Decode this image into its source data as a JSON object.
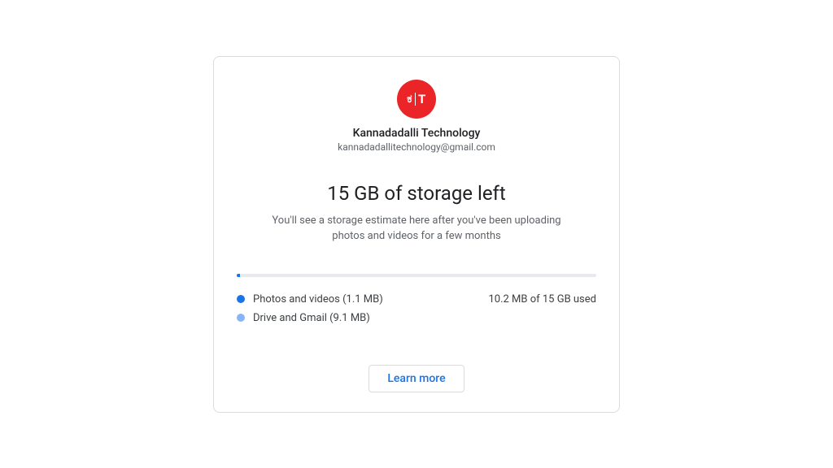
{
  "account": {
    "avatar_left": "ಕ",
    "avatar_right": "T",
    "name": "Kannadadalli Technology",
    "email": "kannadadallitechnology@gmail.com"
  },
  "storage": {
    "title": "15 GB of storage left",
    "subtitle": "You'll see a storage estimate here after you've been uploading photos and videos for a few months",
    "usage_summary": "10.2 MB of 15 GB used",
    "legend": {
      "photos": "Photos and videos (1.1 MB)",
      "drive": "Drive and Gmail (9.1 MB)"
    },
    "colors": {
      "photos": "#1a73e8",
      "drive": "#8ab4f8"
    }
  },
  "buttons": {
    "learn_more": "Learn more"
  }
}
